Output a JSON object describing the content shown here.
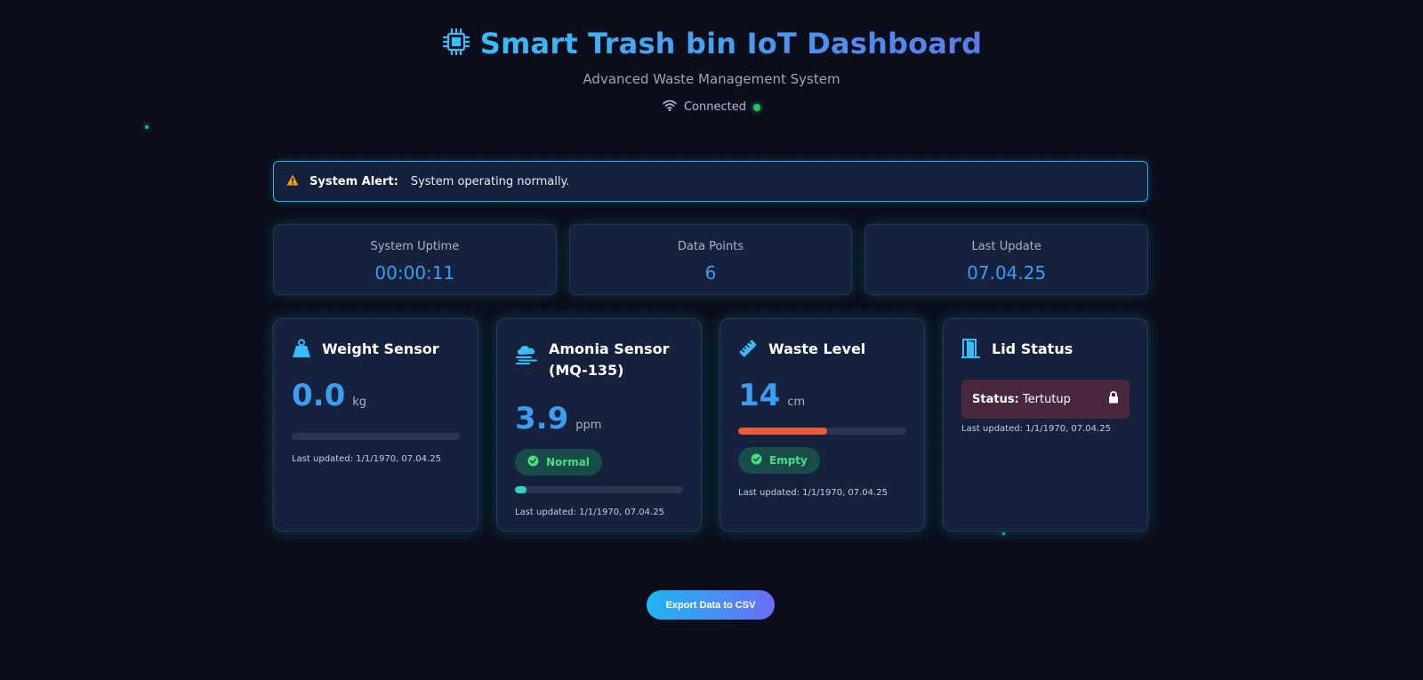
{
  "header": {
    "title": "Smart Trash bin IoT Dashboard",
    "subtitle": "Advanced Waste Management System",
    "connection": "Connected"
  },
  "alert": {
    "label": "System Alert:",
    "message": "System operating normally."
  },
  "stats": [
    {
      "label": "System Uptime",
      "value": "00:00:11"
    },
    {
      "label": "Data Points",
      "value": "6"
    },
    {
      "label": "Last Update",
      "value": "07.04.25"
    }
  ],
  "sensors": {
    "weight": {
      "title": "Weight Sensor",
      "value": "0.0",
      "unit": "kg",
      "fill_percent": 0,
      "updated": "Last updated: 1/1/1970, 07.04.25"
    },
    "ammonia": {
      "title_line1": "Amonia Sensor",
      "title_line2": "(MQ-135)",
      "value": "3.9",
      "unit": "ppm",
      "badge": "Normal",
      "fill_percent": 7,
      "updated": "Last updated: 1/1/1970, 07.04.25"
    },
    "waste": {
      "title": "Waste Level",
      "value": "14",
      "unit": "cm",
      "fill_percent": 53,
      "badge": "Empty",
      "updated": "Last updated: 1/1/1970, 07.04.25"
    },
    "lid": {
      "title": "Lid Status",
      "status_label": "Status:",
      "status_value": "Tertutup",
      "updated": "Last updated: 1/1/1970, 07.04.25"
    }
  },
  "export_label": "Export Data to CSV",
  "colors": {
    "accent": "#3b9ef0",
    "ok": "#22c55e",
    "ammonia_bar": "#2dd4bf",
    "waste_bar": "#ef5a3c"
  },
  "icons": [
    "cpu-chip-icon",
    "wifi-icon",
    "warning-icon",
    "weight-icon",
    "smog-icon",
    "ruler-icon",
    "door-icon",
    "check-circle-icon",
    "lock-icon"
  ]
}
